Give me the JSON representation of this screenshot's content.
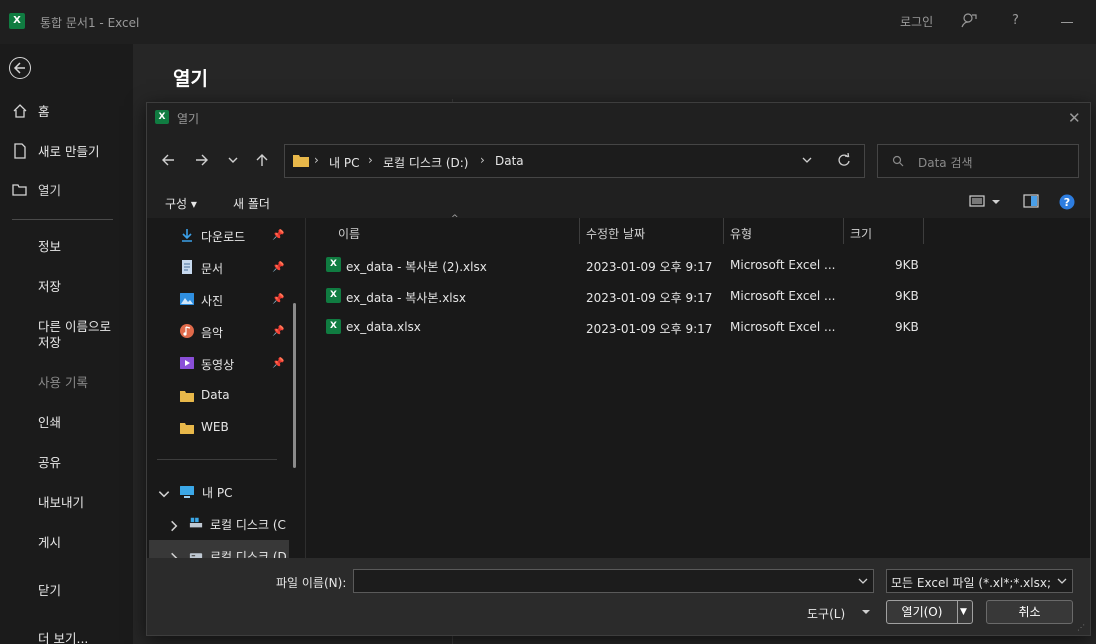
{
  "titlebar": {
    "doc_title": "통합 문서1  -  Excel",
    "login": "로그인",
    "help": "?"
  },
  "nav": {
    "home": "홈",
    "new": "새로 만들기",
    "open": "열기",
    "info": "정보",
    "save": "저장",
    "save_as_1": "다른 이름으로",
    "save_as_2": "저장",
    "history": "사용 기록",
    "print": "인쇄",
    "share": "공유",
    "export": "내보내기",
    "publish": "게시",
    "close": "닫기",
    "more": "더 보기..."
  },
  "main": {
    "heading": "열기"
  },
  "dialog": {
    "title": "열기",
    "address": {
      "crumbs": [
        "내 PC",
        "로컬 디스크 (D:)",
        "Data"
      ]
    },
    "search": {
      "placeholder": "Data 검색"
    },
    "toolbar": {
      "organize": "구성",
      "new_folder": "새 폴더"
    },
    "tree": {
      "items": [
        {
          "label": "다운로드",
          "pinned": true
        },
        {
          "label": "문서",
          "pinned": true
        },
        {
          "label": "사진",
          "pinned": true
        },
        {
          "label": "음악",
          "pinned": true
        },
        {
          "label": "동영상",
          "pinned": true
        },
        {
          "label": "Data",
          "pinned": false
        },
        {
          "label": "WEB",
          "pinned": false
        }
      ],
      "this_pc": "내 PC",
      "drive_c": "로컬 디스크 (C",
      "drive_d": "로컬 디스크 (D"
    },
    "columns": {
      "name": "이름",
      "date": "수정한 날짜",
      "type": "유형",
      "size": "크기"
    },
    "files": [
      {
        "name": "ex_data - 복사본 (2).xlsx",
        "date": "2023-01-09 오후 9:17",
        "type": "Microsoft Excel ...",
        "size": "9KB"
      },
      {
        "name": "ex_data - 복사본.xlsx",
        "date": "2023-01-09 오후 9:17",
        "type": "Microsoft Excel ...",
        "size": "9KB"
      },
      {
        "name": "ex_data.xlsx",
        "date": "2023-01-09 오후 9:17",
        "type": "Microsoft Excel ...",
        "size": "9KB"
      }
    ],
    "bottom": {
      "filename_label": "파일 이름(N):",
      "filename_value": "",
      "filetype": "모든 Excel 파일 (*.xl*;*.xlsx;*.xl",
      "tools": "도구(L)",
      "open": "열기(O)",
      "cancel": "취소"
    }
  },
  "colors": {
    "excel_green": "#107c41",
    "background": "#1b1b1b",
    "dialog": "#202020"
  }
}
